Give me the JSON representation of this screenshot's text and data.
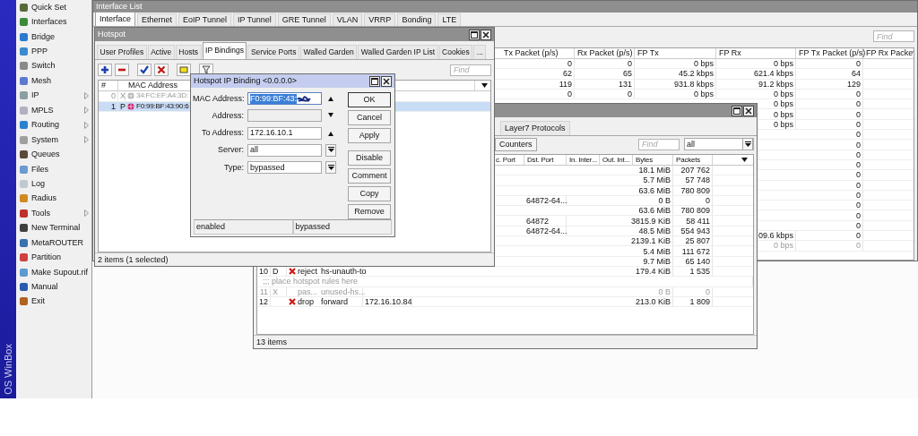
{
  "brand": "OS WinBox",
  "sidebar": {
    "items": [
      {
        "label": "Quick Set",
        "has_submenu": false
      },
      {
        "label": "Interfaces",
        "has_submenu": false
      },
      {
        "label": "Bridge",
        "has_submenu": false
      },
      {
        "label": "PPP",
        "has_submenu": false
      },
      {
        "label": "Switch",
        "has_submenu": false
      },
      {
        "label": "Mesh",
        "has_submenu": false
      },
      {
        "label": "IP",
        "has_submenu": true
      },
      {
        "label": "MPLS",
        "has_submenu": true
      },
      {
        "label": "Routing",
        "has_submenu": true
      },
      {
        "label": "System",
        "has_submenu": true
      },
      {
        "label": "Queues",
        "has_submenu": false
      },
      {
        "label": "Files",
        "has_submenu": false
      },
      {
        "label": "Log",
        "has_submenu": false
      },
      {
        "label": "Radius",
        "has_submenu": false
      },
      {
        "label": "Tools",
        "has_submenu": true
      },
      {
        "label": "New Terminal",
        "has_submenu": false
      },
      {
        "label": "MetaROUTER",
        "has_submenu": false
      },
      {
        "label": "Partition",
        "has_submenu": false
      },
      {
        "label": "Make Supout.rif",
        "has_submenu": false
      },
      {
        "label": "Manual",
        "has_submenu": false
      },
      {
        "label": "Exit",
        "has_submenu": false
      }
    ]
  },
  "interface_list": {
    "title": "Interface List",
    "tabs": [
      {
        "label": "Interface",
        "selected": true
      },
      {
        "label": "Ethernet",
        "selected": false
      },
      {
        "label": "EoIP Tunnel",
        "selected": false
      },
      {
        "label": "IP Tunnel",
        "selected": false
      },
      {
        "label": "GRE Tunnel",
        "selected": false
      },
      {
        "label": "VLAN",
        "selected": false
      },
      {
        "label": "VRRP",
        "selected": false
      },
      {
        "label": "Bonding",
        "selected": false
      },
      {
        "label": "LTE",
        "selected": false
      }
    ],
    "find_placeholder": "Find",
    "columns": [
      "Tx Packet (p/s)",
      "Rx Packet (p/s)",
      "FP Tx",
      "FP Rx",
      "FP Tx Packet (p/s)",
      "FP Rx Packe"
    ],
    "rows": [
      {
        "tx_packet": "0",
        "rx_packet": "0",
        "fp_tx": "0 bps",
        "fp_rx": "0 bps",
        "fp_tx_packet": "0",
        "disabled": false
      },
      {
        "tx_packet": "62",
        "rx_packet": "65",
        "fp_tx": "45.2 kbps",
        "fp_rx": "621.4 kbps",
        "fp_tx_packet": "64",
        "disabled": false
      },
      {
        "tx_packet": "119",
        "rx_packet": "131",
        "fp_tx": "931.8 kbps",
        "fp_rx": "91.2 kbps",
        "fp_tx_packet": "129",
        "disabled": false
      },
      {
        "tx_packet": "0",
        "rx_packet": "0",
        "fp_tx": "0 bps",
        "fp_rx": "0 bps",
        "fp_tx_packet": "0",
        "disabled": false
      },
      {
        "fp_rx": "0 bps",
        "fp_tx_packet": "0",
        "disabled": false
      },
      {
        "fp_rx": "0 bps",
        "fp_tx_packet": "0",
        "disabled": false
      },
      {
        "fp_rx": "0 bps",
        "fp_tx_packet": "0",
        "disabled": false
      },
      {
        "fp_tx_packet": "0",
        "disabled": false
      },
      {
        "fp_tx_packet": "0",
        "disabled": false
      },
      {
        "fp_tx_packet": "0",
        "disabled": false
      },
      {
        "fp_tx_packet": "0",
        "disabled": false
      },
      {
        "fp_tx_packet": "0",
        "disabled": false
      },
      {
        "fp_tx_packet": "0",
        "disabled": false
      },
      {
        "fp_tx_packet": "0",
        "disabled": false
      },
      {
        "fp_tx_packet": "0",
        "disabled": false
      },
      {
        "fp_tx_packet": "0",
        "disabled": false
      },
      {
        "fp_tx_packet": "0",
        "disabled": false
      },
      {
        "fp_rx": "09.6 kbps",
        "fp_tx_packet": "0",
        "disabled": false
      },
      {
        "fp_rx": "0 bps",
        "fp_tx_packet": "0",
        "disabled": true
      }
    ]
  },
  "firewall": {
    "tabs": [
      {
        "label": "Layer7 Protocols",
        "selected": false
      }
    ],
    "counters_button": "Counters",
    "find_placeholder": "Find",
    "filter": "all",
    "columns": [
      "c. Port",
      "Dst. Port",
      "In. Inter...",
      "Out. Int...",
      "Bytes",
      "Packets"
    ],
    "rows": [
      {
        "kind": "rule",
        "bytes": "18.1 MiB",
        "packets": "207 762",
        "cross_icon": false,
        "disabled": false
      },
      {
        "kind": "rule",
        "bytes": "5.7 MiB",
        "packets": "57 748",
        "cross_icon": false,
        "disabled": false
      },
      {
        "kind": "rule",
        "bytes": "63.6 MiB",
        "packets": "780 809",
        "cross_icon": false,
        "disabled": false
      },
      {
        "kind": "rule",
        "dst_port": "64872-64...",
        "bytes": "0 B",
        "packets": "0",
        "cross_icon": false,
        "disabled": false
      },
      {
        "kind": "rule",
        "bytes": "63.6 MiB",
        "packets": "780 809",
        "cross_icon": false,
        "disabled": false
      },
      {
        "kind": "rule",
        "dst_port": "64872",
        "bytes": "3815.9 KiB",
        "packets": "58 411",
        "cross_icon": false,
        "disabled": false
      },
      {
        "kind": "rule",
        "dst_port": "64872-64...",
        "bytes": "48.5 MiB",
        "packets": "554 943",
        "cross_icon": false,
        "disabled": false
      },
      {
        "kind": "rule",
        "bytes": "2139.1 KiB",
        "packets": "25 807",
        "cross_icon": false,
        "disabled": false
      },
      {
        "kind": "rule",
        "bytes": "5.4 MiB",
        "packets": "111 672",
        "cross_icon": false,
        "disabled": false
      },
      {
        "kind": "rule",
        "bytes": "9.7 MiB",
        "packets": "65 140",
        "cross_icon": false,
        "disabled": false
      },
      {
        "kind": "rule",
        "number": "10",
        "flag": "D",
        "action": "reject",
        "chain": "hs-unauth-to",
        "bytes": "179.4 KiB",
        "packets": "1 535",
        "cross_icon": true,
        "disabled": false
      },
      {
        "kind": "comment",
        "text": ";;; place hotspot rules here"
      },
      {
        "kind": "rule",
        "number": "11",
        "flag": "X",
        "action": "pas...",
        "chain": "unused-hs...",
        "bytes": "0 B",
        "packets": "0",
        "cross_icon": false,
        "disabled": true
      },
      {
        "kind": "rule",
        "number": "12",
        "action": "drop",
        "chain": "forward",
        "src_address": "172.16.10.84",
        "bytes": "213.0 KiB",
        "packets": "1 809",
        "cross_icon": true,
        "disabled": false
      }
    ],
    "status": "13 items"
  },
  "hotspot": {
    "title": "Hotspot",
    "tabs": [
      {
        "label": "User Profiles",
        "selected": false
      },
      {
        "label": "Active",
        "selected": false
      },
      {
        "label": "Hosts",
        "selected": false
      },
      {
        "label": "IP Bindings",
        "selected": true
      },
      {
        "label": "Service Ports",
        "selected": false
      },
      {
        "label": "Walled Garden",
        "selected": false
      },
      {
        "label": "Walled Garden IP List",
        "selected": false
      },
      {
        "label": "Cookies",
        "selected": false
      },
      {
        "label": "...",
        "selected": false
      }
    ],
    "find_placeholder": "Find",
    "columns": [
      "#",
      "MAC Address"
    ],
    "rows": [
      {
        "number": "0",
        "flag": "X",
        "mac": "34:FC:EF:A4:3D:",
        "disabled": true,
        "selected": false
      },
      {
        "number": "1",
        "flag": "P",
        "mac": "F0:99:BF:43:90:6",
        "disabled": false,
        "selected": true
      }
    ],
    "status": "2 items (1 selected)"
  },
  "ip_binding_dialog": {
    "title": "Hotspot IP Binding <0.0.0.0>",
    "fields": [
      {
        "label": "MAC Address:",
        "value": "F0:99:BF:43:",
        "kind": "collapsible",
        "disabled": false,
        "highlighted": true,
        "redacted": true
      },
      {
        "label": "Address:",
        "kind": "expandable",
        "disabled": true,
        "highlighted": false,
        "redacted": false
      },
      {
        "label": "To Address:",
        "value": "172.16.10.1",
        "kind": "collapsible",
        "disabled": false,
        "highlighted": false,
        "redacted": false
      },
      {
        "label": "Server:",
        "value": "all",
        "kind": "select",
        "disabled": false,
        "highlighted": false,
        "redacted": false
      },
      {
        "label": "Type:",
        "value": "bypassed",
        "kind": "select",
        "disabled": false,
        "highlighted": false,
        "redacted": false
      }
    ],
    "buttons": [
      {
        "label": "OK",
        "default": true
      },
      {
        "label": "Cancel",
        "default": false
      },
      {
        "label": "Apply",
        "default": false
      },
      {
        "label": "Disable",
        "default": false
      },
      {
        "label": "Comment",
        "default": false
      },
      {
        "label": "Copy",
        "default": false
      },
      {
        "label": "Remove",
        "default": false
      }
    ],
    "status": [
      "enabled",
      "bypassed"
    ]
  }
}
